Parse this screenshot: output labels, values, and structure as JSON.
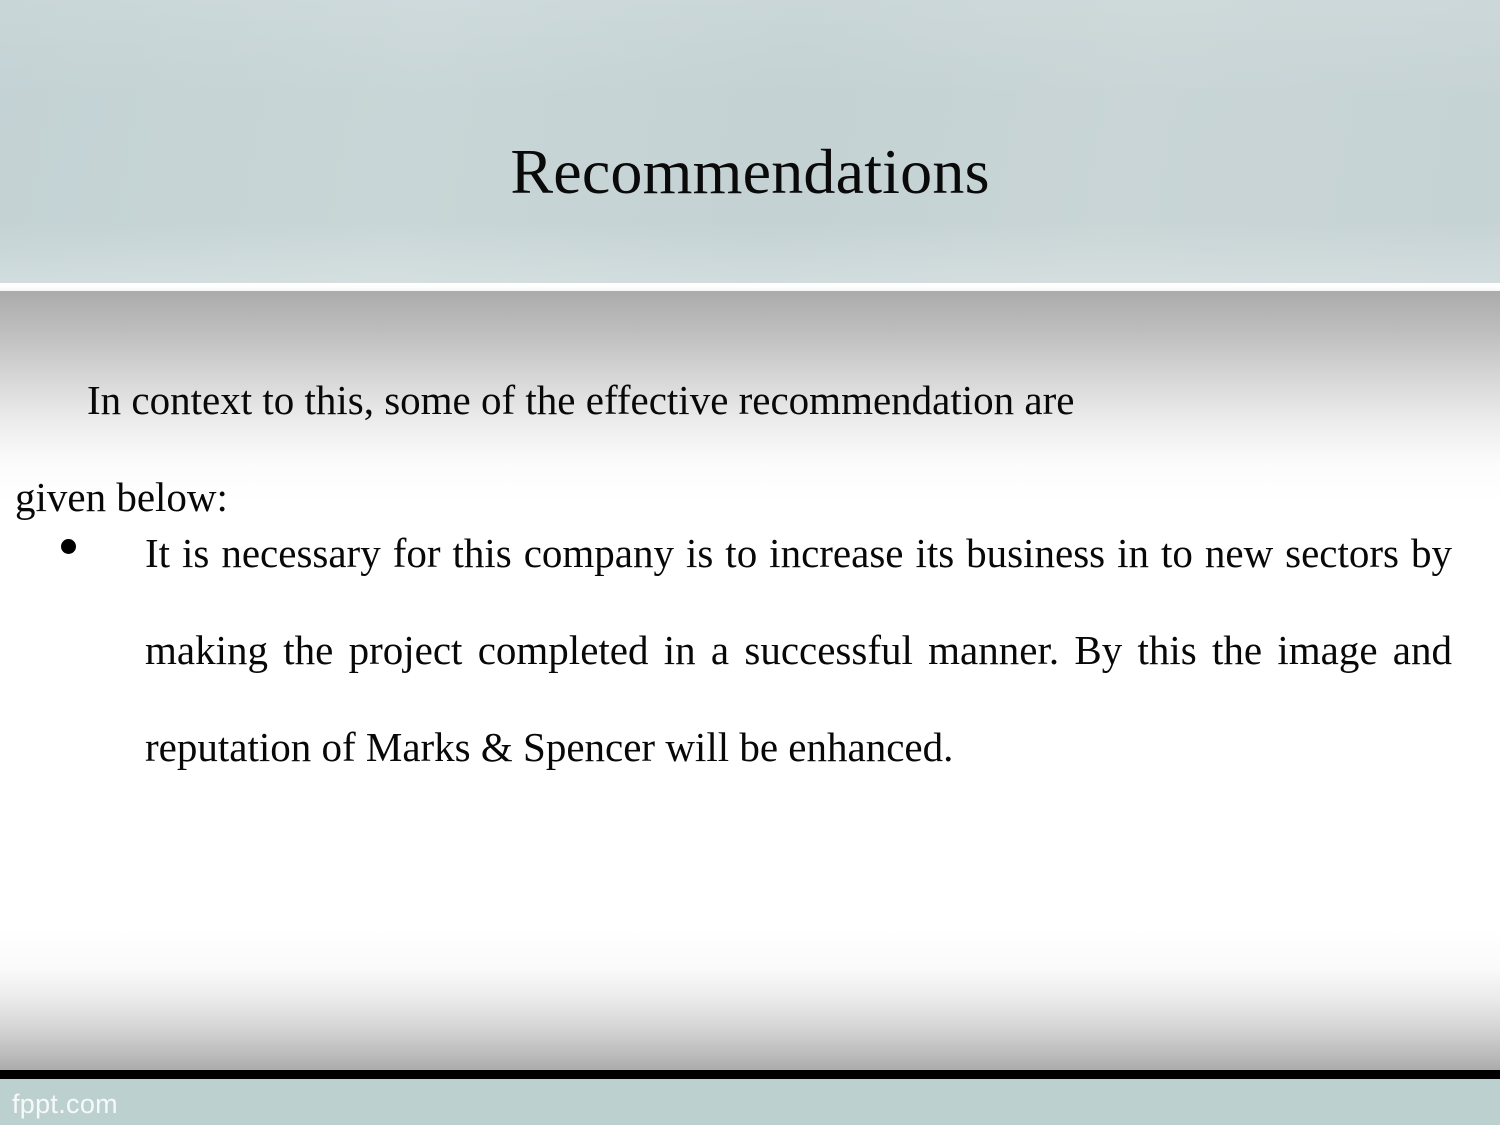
{
  "slide": {
    "title": "Recommendations",
    "header": {
      "background_color": "#c6d3d5",
      "title_color": "#0a0a0a"
    },
    "body": {
      "intro_paragraph": "In context to this, some of the effective recommendation are given below:",
      "intro_line_1": "In context to this, some of the effective recommendation are",
      "intro_line_2": "given below:",
      "bullets": [
        {
          "marker": "•",
          "text": "It is necessary for this company is to increase its business in to new sectors by making the project completed in a successful manner. By this the image and reputation of Marks & Spencer will be enhanced."
        }
      ],
      "text_color": "#080808"
    },
    "footer": {
      "watermark": "fppt.com",
      "band_color": "#bdd0d0",
      "rule_color": "#000000",
      "watermark_color": "#ffffff"
    }
  }
}
